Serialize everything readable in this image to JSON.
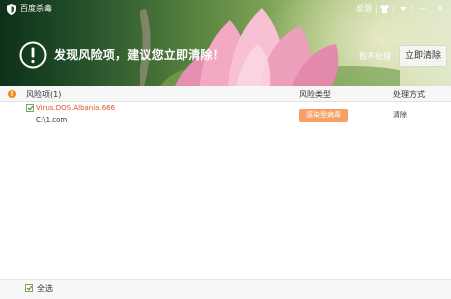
{
  "window": {
    "title": "百度杀毒",
    "feedback_label": "反馈",
    "skin_icon": "shirt-icon",
    "menu_icon": "chevron-down-icon",
    "minimize_label": "—",
    "close_label": "✕"
  },
  "banner": {
    "headline": "发现风险项，建议您立即清除！",
    "ignore_label": "暂不处理",
    "clean_label": "立即清除",
    "warn_icon": "exclamation-circle-icon"
  },
  "table": {
    "headers": {
      "item": "风险项(1)",
      "type": "风险类型",
      "action": "处理方式"
    },
    "rows": [
      {
        "checked": true,
        "name": "Virus.DOS.Albania.666",
        "path": "C:\\1.com",
        "type": "感染型病毒",
        "action": "清除"
      }
    ]
  },
  "footer": {
    "select_all_label": "全选",
    "select_all_checked": true
  },
  "colors": {
    "threat_red": "#e04e2a",
    "badge_orange": "#f6a064",
    "header_icon_orange": "#f08a1d"
  }
}
